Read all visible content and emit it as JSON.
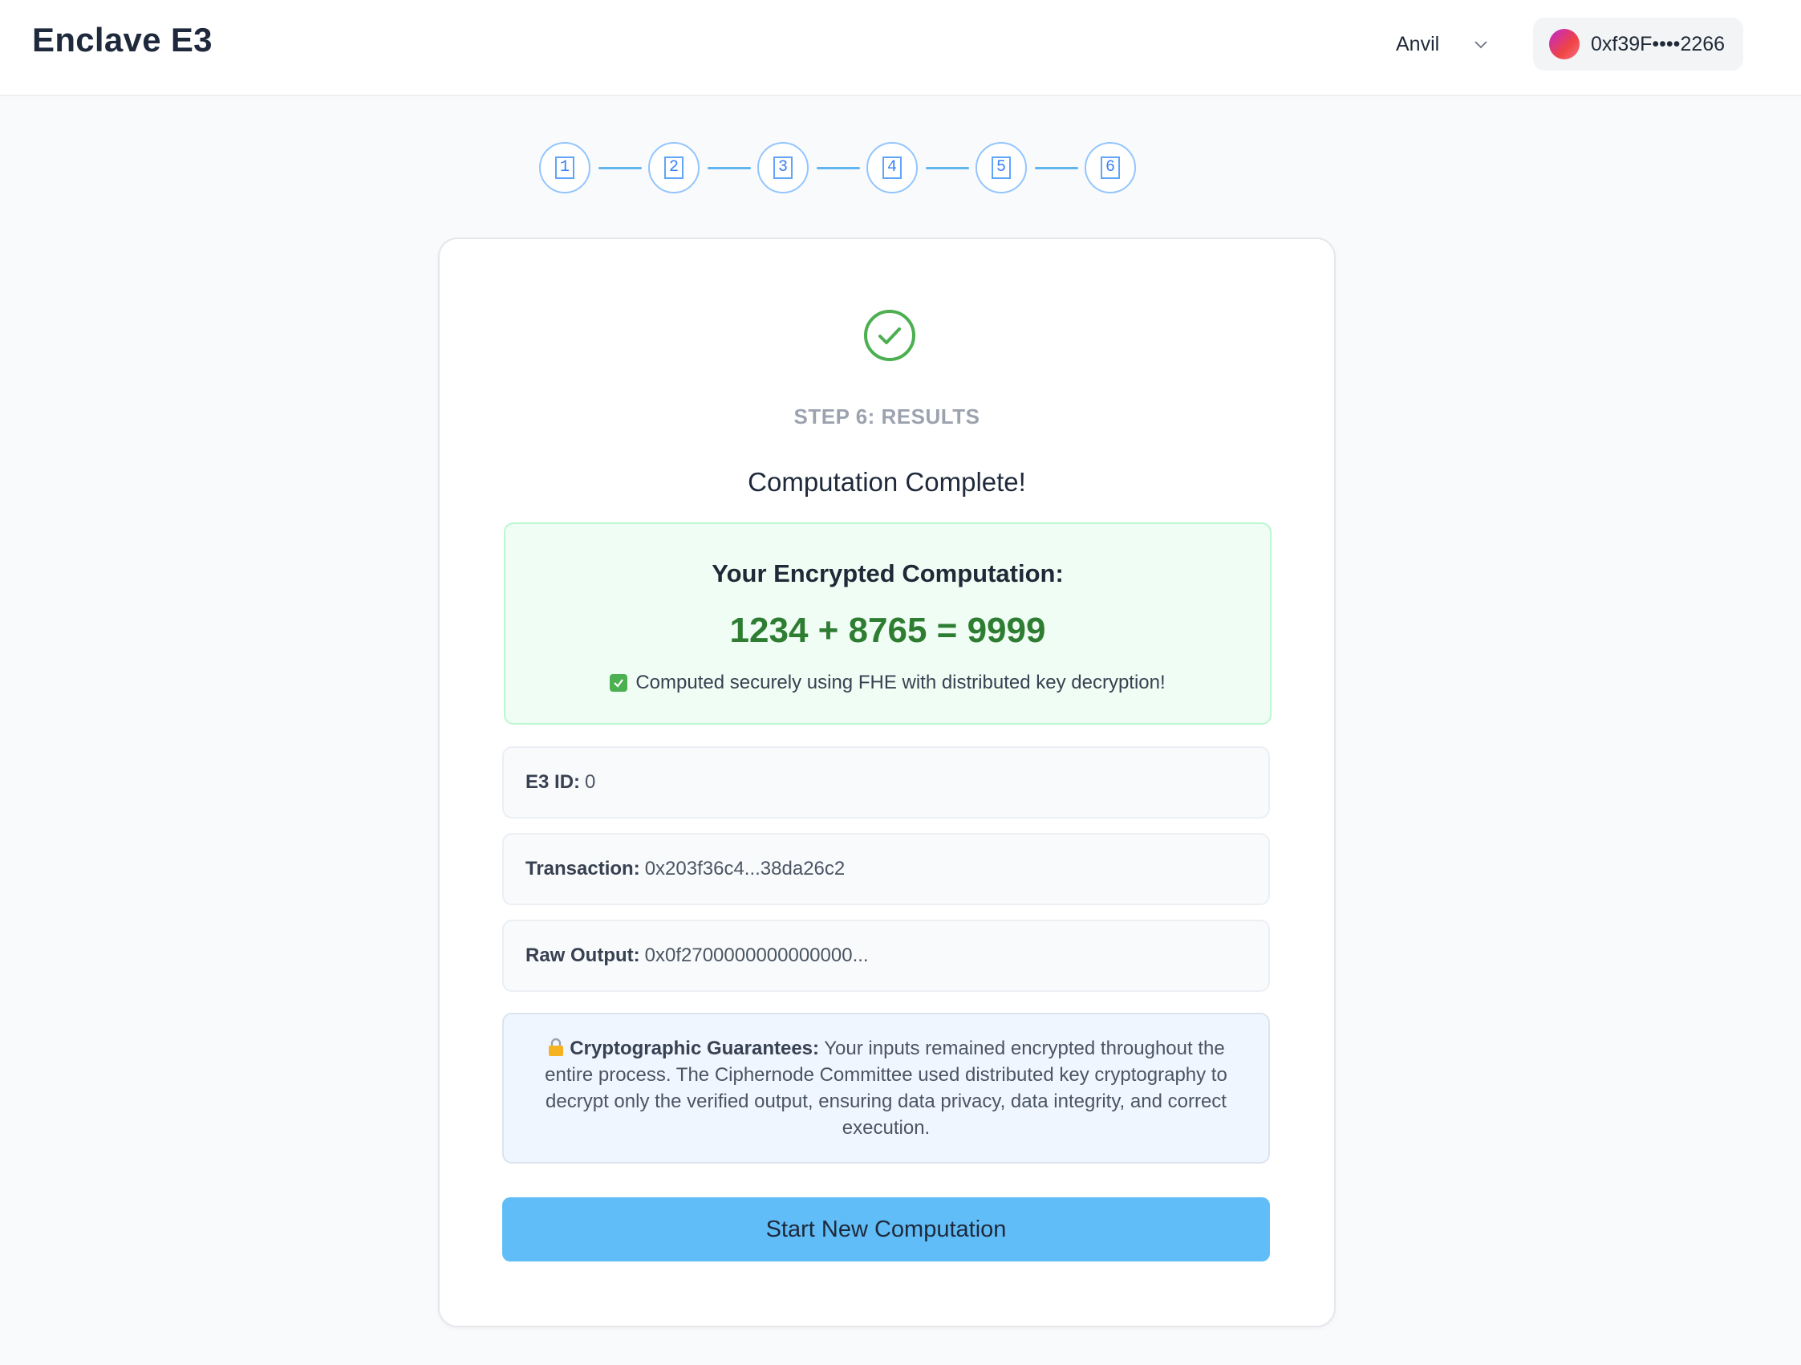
{
  "header": {
    "app_title": "Enclave E3",
    "network": "Anvil",
    "account_address": "0xf39F••••2266"
  },
  "stepper": {
    "steps": [
      "1",
      "2",
      "3",
      "4",
      "5",
      "6"
    ]
  },
  "card": {
    "step_label": "STEP 6: RESULTS",
    "title": "Computation Complete!",
    "result": {
      "heading": "Your Encrypted Computation:",
      "equation": "1234 + 8765 = 9999",
      "note": "Computed securely using FHE with distributed key decryption!"
    },
    "info": {
      "e3_id_label": "E3 ID:",
      "e3_id_value": "0",
      "transaction_label": "Transaction:",
      "transaction_value": "0x203f36c4...38da26c2",
      "raw_output_label": "Raw Output:",
      "raw_output_value": "0x0f2700000000000000..."
    },
    "guarantee": {
      "label": "Cryptographic Guarantees:",
      "text": "Your inputs remained encrypted throughout the entire process. The Ciphernode Committee used distributed key cryptography to decrypt only the verified output, ensuring data privacy, data integrity, and correct execution."
    },
    "start_button": "Start New Computation"
  },
  "colors": {
    "accent": "#60bdf7",
    "success": "#2e7d32",
    "success_bg": "#f0fdf4",
    "info_bg": "#eff6ff"
  },
  "icons": {
    "network_dropdown": "chevron-down-icon",
    "success": "check-circle-icon",
    "note": "check-box-icon",
    "guarantee": "lock-icon"
  }
}
